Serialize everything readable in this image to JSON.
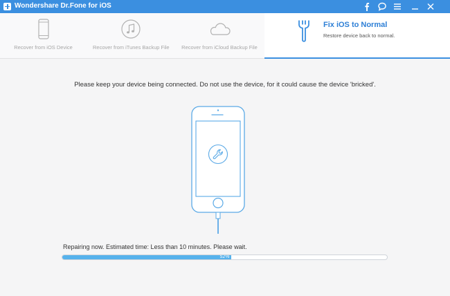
{
  "window": {
    "title": "Wondershare Dr.Fone for iOS",
    "controls": [
      "facebook-icon",
      "feedback-icon",
      "menu-icon",
      "minimize-icon",
      "close-icon"
    ]
  },
  "toolbar": {
    "items": [
      {
        "label": "Recover from iOS Device",
        "icon": "phone-icon"
      },
      {
        "label": "Recover from iTunes Backup File",
        "icon": "music-note-icon"
      },
      {
        "label": "Recover from iCloud Backup File",
        "icon": "cloud-icon"
      }
    ],
    "active": {
      "title": "Fix iOS to Normal",
      "subtitle": "Restore device back to normal.",
      "icon": "wrench-icon"
    }
  },
  "main": {
    "message": "Please keep your device being connected. Do not use the device, for it could cause the device  'bricked'.",
    "status": "Repairing now. Estimated time: Less than 10 minutes. Please wait.",
    "progress": {
      "percent": 0.52,
      "label": "52%"
    }
  },
  "colors": {
    "accent": "#3b8fe0",
    "progress_fill": "#56b2ec",
    "phone_outline": "#5aa9e6"
  }
}
